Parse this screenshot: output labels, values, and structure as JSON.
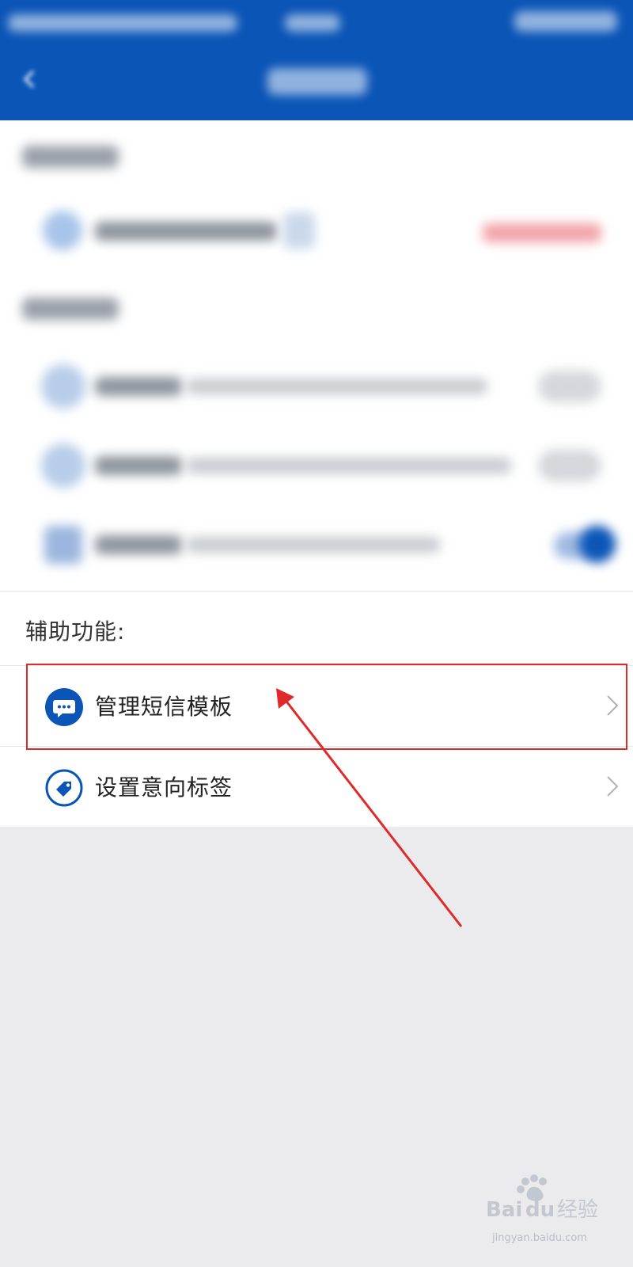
{
  "colors": {
    "header_bg": "#0b55b7",
    "accent_blue": "#0b55b7",
    "highlight_red": "#e02a2a",
    "page_bg": "#ebebee"
  },
  "aux_section": {
    "title": "辅助功能:",
    "items": [
      {
        "label": "管理短信模板",
        "icon": "message-bubble-icon"
      },
      {
        "label": "设置意向标签",
        "icon": "tag-icon"
      }
    ]
  },
  "watermark": {
    "logo_text": "Bai du 经验",
    "url": "jingyan.baidu.com"
  }
}
